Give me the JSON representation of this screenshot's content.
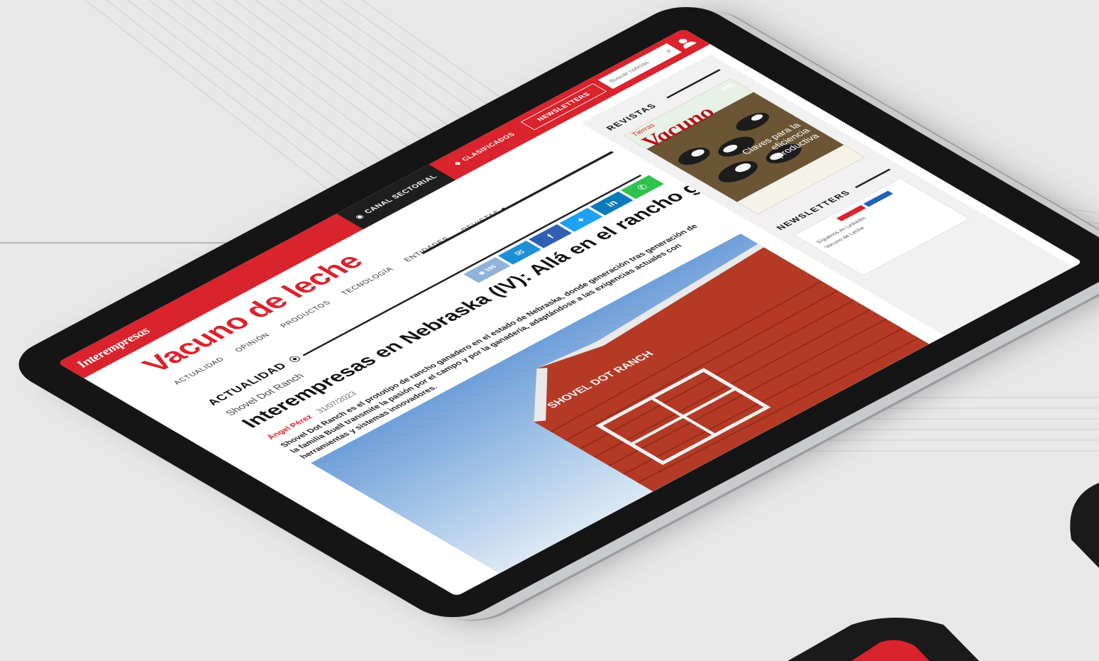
{
  "header": {
    "logo": "Interempresas",
    "channel": "CANAL SECTORIAL",
    "classifieds": "CLASIFICADOS",
    "newsletters": "NEWSLETTERS",
    "search_placeholder": "Buscar noticias"
  },
  "site": {
    "title": "Vacuno de leche",
    "nav": [
      "ACTUALIDAD",
      "OPINIÓN",
      "PRODUCTOS",
      "TECNOLOGÍA",
      "ENTIDADES",
      "REVISTAS ▾"
    ]
  },
  "article": {
    "section": "ACTUALIDAD",
    "section_icon": "rss-icon",
    "kicker": "Shovel Dot Ranch",
    "headline": "Interempresas en Nebraska (IV): Allá en el rancho grande",
    "author": "Ángel Pérez",
    "date": "31/07/2023",
    "lead": "Shovel Dot Ranch es el prototipo de rancho ganadero en el estado de Nebraska, donde generación tras generación de la familia Buell transmite la pasión por el campo y por la ganadería, adaptándose a las exigencias actuales con herramientas y sistemas innovadores.",
    "views": "105",
    "share": [
      "email",
      "facebook",
      "twitter",
      "linkedin",
      "whatsapp"
    ],
    "image_text": "SHOVEL DOT RANCH"
  },
  "sidebar": {
    "revistas_label": "REVISTAS",
    "newsletters_label": "NEWSLETTERS",
    "magazine": {
      "top": "Tierras",
      "title": "Vacuno",
      "issue": "001",
      "tagline": "Claves para la eficiencia productiva"
    },
    "newsletter_preview": {
      "line1": "Síguenos en LinkedIn",
      "line2": "Vacuno de Leche"
    }
  },
  "colors": {
    "brand_red": "#d9232d",
    "dark": "#1e1e1e"
  }
}
